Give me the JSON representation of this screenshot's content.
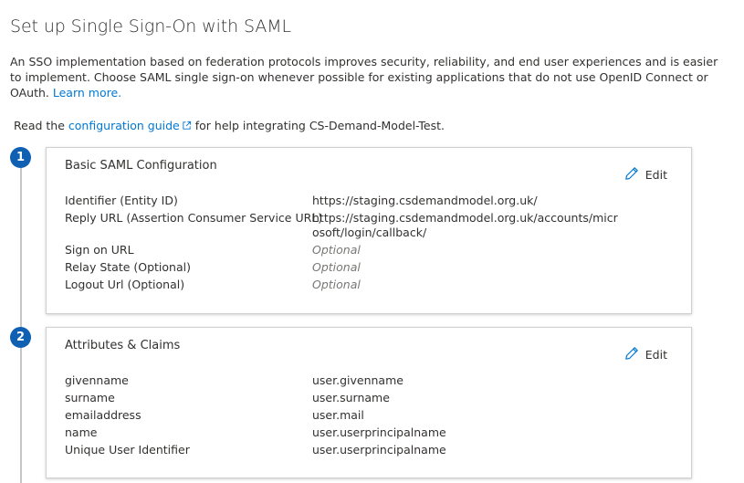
{
  "page": {
    "title": "Set up Single Sign-On with SAML",
    "intro_text": "An SSO implementation based on federation protocols improves security, reliability, and end user experiences and is easier to implement. Choose SAML single sign-on whenever possible for existing applications that do not use OpenID Connect or OAuth.",
    "learn_more": "Learn more.",
    "read_prefix": "Read the",
    "config_guide_link": "configuration guide",
    "read_suffix": "for help integrating CS-Demand-Model-Test."
  },
  "steps": {
    "basic": {
      "number": "1",
      "title": "Basic SAML Configuration",
      "edit_label": "Edit",
      "rows": [
        {
          "label": "Identifier (Entity ID)",
          "value": "https://staging.csdemandmodel.org.uk/"
        },
        {
          "label": "Reply URL (Assertion Consumer Service URL)",
          "value": "https://staging.csdemandmodel.org.uk/accounts/microsoft/login/callback/"
        },
        {
          "label": "Sign on URL",
          "value": "Optional"
        },
        {
          "label": "Relay State (Optional)",
          "value": "Optional"
        },
        {
          "label": "Logout Url (Optional)",
          "value": "Optional"
        }
      ]
    },
    "claims": {
      "number": "2",
      "title": "Attributes & Claims",
      "edit_label": "Edit",
      "rows": [
        {
          "label": "givenname",
          "value": "user.givenname"
        },
        {
          "label": "surname",
          "value": "user.surname"
        },
        {
          "label": "emailaddress",
          "value": "user.mail"
        },
        {
          "label": "name",
          "value": "user.userprincipalname"
        },
        {
          "label": "Unique User Identifier",
          "value": "user.userprincipalname"
        }
      ]
    }
  },
  "colors": {
    "accent": "#0078d4",
    "step_badge": "#0f5fb3",
    "optional_text": "#797775"
  },
  "icons": {
    "edit": "pencil-icon",
    "external": "external-link-icon"
  }
}
